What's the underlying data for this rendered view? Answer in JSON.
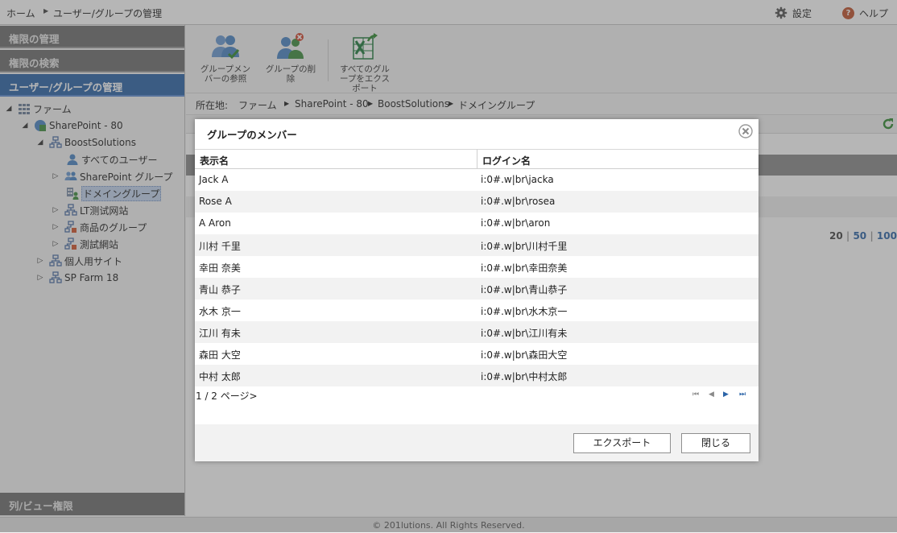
{
  "topbar": {
    "breadcrumb": [
      "ホーム",
      "ユーザー/グループの管理"
    ],
    "settings_label": "設定",
    "help_label": "ヘルプ"
  },
  "sidebar": {
    "sections": [
      "権限の管理",
      "権限の検索",
      "ユーザー/グループの管理"
    ],
    "bottom_section": "列/ビュー権限",
    "tree": [
      {
        "label": "ファーム"
      },
      {
        "label": "SharePoint - 80"
      },
      {
        "label": "BoostSolutions"
      },
      {
        "label": "すべてのユーザー"
      },
      {
        "label": "SharePoint グループ"
      },
      {
        "label": "ドメイングループ"
      },
      {
        "label": "LT测试网站"
      },
      {
        "label": "商品のグループ"
      },
      {
        "label": "測試網站"
      },
      {
        "label": "個人用サイト"
      },
      {
        "label": "SP Farm 18"
      }
    ]
  },
  "toolbar": {
    "view_members": "グループメンバーの参照",
    "delete_group": "グループの削除",
    "export_all": "すべてのグループをエクスポート"
  },
  "location": {
    "label": "所在地:",
    "path": [
      "ファーム",
      "SharePoint - 80",
      "BoostSolutions",
      "ドメイングループ"
    ]
  },
  "background_pager": [
    "20",
    "50",
    "100"
  ],
  "footer": "© 201lutions. All Rights Reserved.",
  "dialog": {
    "title": "グループのメンバー",
    "columns": [
      "表示名",
      "ログイン名"
    ],
    "rows": [
      {
        "name": "Jack A",
        "login": "i:0#.w|br\\jacka"
      },
      {
        "name": "Rose A",
        "login": "i:0#.w|br\\rosea"
      },
      {
        "name": "A Aron",
        "login": "i:0#.w|br\\aron"
      },
      {
        "name": "川村 千里",
        "login": "i:0#.w|br\\川村千里"
      },
      {
        "name": "幸田 奈美",
        "login": "i:0#.w|br\\幸田奈美"
      },
      {
        "name": "青山 恭子",
        "login": "i:0#.w|br\\青山恭子"
      },
      {
        "name": "水木 京一",
        "login": "i:0#.w|br\\水木京一"
      },
      {
        "name": "江川 有未",
        "login": "i:0#.w|br\\江川有未"
      },
      {
        "name": "森田 大空",
        "login": "i:0#.w|br\\森田大空"
      },
      {
        "name": "中村 太郎",
        "login": "i:0#.w|br\\中村太郎"
      }
    ],
    "page_info": "1 / 2 ページ>",
    "export_button": "エクスポート",
    "close_button": "閉じる"
  },
  "colors": {
    "accent": "#2b64a8",
    "nav_dark": "#6e6e6e",
    "excel_green": "#1e7a3c"
  }
}
